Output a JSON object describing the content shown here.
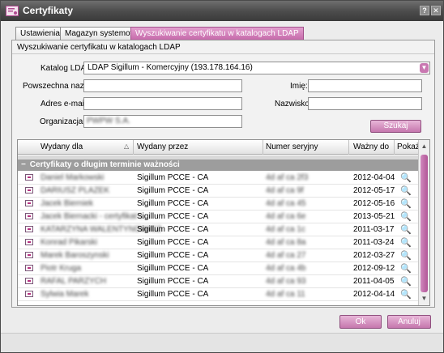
{
  "window": {
    "title": "Certyfikaty",
    "help_glyph": "?",
    "close_glyph": "✕"
  },
  "tabs": [
    {
      "label": "Ustawienia",
      "active": false
    },
    {
      "label": "Magazyn systemowy",
      "active": false
    },
    {
      "label": "Wyszukiwanie certyfikatu w katalogach LDAP",
      "active": true
    }
  ],
  "search_panel": {
    "title": "Wyszukiwanie certyfikatu w katalogach LDAP",
    "ldap_catalog_label": "Katalog LDAP",
    "ldap_catalog_value": "LDAP Sigillum - Komercyjny (193.178.164.16)",
    "common_name_label": "Powszechna nazwa:",
    "common_name_value": "",
    "email_label": "Adres e-mail:",
    "email_value": "",
    "organization_label": "Organizacja:",
    "organization_value": "PWPW S.A.",
    "first_name_label": "Imię:",
    "first_name_value": "",
    "last_name_label": "Nazwisko:",
    "last_name_value": "",
    "search_button": "Szukaj"
  },
  "table": {
    "columns": [
      "Wydany dla",
      "Wydany przez",
      "Numer seryjny",
      "Ważny do",
      "Pokaż"
    ],
    "sort_glyph": "△",
    "group_label": "Certyfikaty o długim terminie ważności",
    "group_glyph": "−",
    "show_glyph": "🔍",
    "rows": [
      {
        "issued_to": "Daniel Markowski",
        "issued_by": "Sigillum PCCE - CA",
        "serial": "4d af ca 2f3",
        "valid_to": "2012-04-04"
      },
      {
        "issued_to": "DARIUSZ PLAZEK",
        "issued_by": "Sigillum PCCE - CA",
        "serial": "4d af ca 9f",
        "valid_to": "2012-05-17"
      },
      {
        "issued_to": "Jacek Bierniek",
        "issued_by": "Sigillum PCCE - CA",
        "serial": "4d af ca 45",
        "valid_to": "2012-05-16"
      },
      {
        "issued_to": "Jacek Biernacki - certyfikat t...",
        "issued_by": "Sigillum PCCE - CA",
        "serial": "4d af ca 6e",
        "valid_to": "2013-05-21"
      },
      {
        "issued_to": "KATARZYNA WALENTYNOWICZ",
        "issued_by": "Sigillum PCCE - CA",
        "serial": "4d af ca 1c",
        "valid_to": "2011-03-17"
      },
      {
        "issued_to": "Konrad Pikarski",
        "issued_by": "Sigillum PCCE - CA",
        "serial": "4d af ca 8a",
        "valid_to": "2011-03-24"
      },
      {
        "issued_to": "Marek Baroszynski",
        "issued_by": "Sigillum PCCE - CA",
        "serial": "4d af ca 27",
        "valid_to": "2012-03-27"
      },
      {
        "issued_to": "Piotr Kruga",
        "issued_by": "Sigillum PCCE - CA",
        "serial": "4d af ca 4b",
        "valid_to": "2012-09-12"
      },
      {
        "issued_to": "RAFAL PARZYCH",
        "issued_by": "Sigillum PCCE - CA",
        "serial": "4d af ca 93",
        "valid_to": "2011-04-05"
      },
      {
        "issued_to": "Sylwia Marek",
        "issued_by": "Sigillum PCCE - CA",
        "serial": "4d af ca 11",
        "valid_to": "2012-04-14"
      }
    ]
  },
  "footer": {
    "ok_button": "Ok",
    "cancel_button": "Anuluj"
  },
  "scroll_glyphs": {
    "up": "▲",
    "down": "▼",
    "dropdown": "▼"
  },
  "colors": {
    "accent": "#c46aa9",
    "group_bar": "#9d9d9d",
    "titlebar": "#4d4d4d"
  }
}
